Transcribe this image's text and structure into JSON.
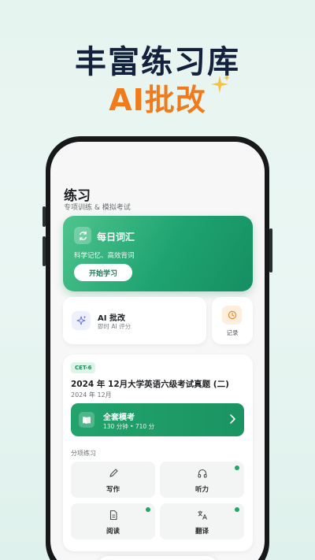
{
  "promo": {
    "headline_line1": "丰富练习库",
    "headline_line2": "AI批改"
  },
  "page": {
    "title": "练习",
    "subtitle": "专项训练 & 模拟考试"
  },
  "daily_vocab": {
    "title": "每日词汇",
    "subtitle": "科学记忆、高效背词",
    "button_label": "开始学习",
    "icon": "refresh-icon"
  },
  "ai_grading": {
    "title": "AI 批改",
    "subtitle": "即时 AI 评分",
    "icon": "sparkle-icon"
  },
  "records": {
    "label": "记录",
    "icon": "clock-icon"
  },
  "exam": {
    "level_badge": "CET-6",
    "title": "2024 年 12月大学英语六级考试真题 (二)",
    "date": "2024 年 12月",
    "mock": {
      "title": "全套模考",
      "subtitle": "130 分钟 • 710 分",
      "icon": "open-book-icon"
    },
    "section_label": "分项练习",
    "sections": [
      {
        "label": "写作",
        "icon": "pen-icon",
        "completed": false
      },
      {
        "label": "听力",
        "icon": "headphones-icon",
        "completed": true
      },
      {
        "label": "阅读",
        "icon": "document-icon",
        "completed": true
      },
      {
        "label": "翻译",
        "icon": "translate-icon",
        "completed": true
      }
    ]
  },
  "colors": {
    "brand_green": "#1ea370",
    "accent_orange": "#f07b1d",
    "headline_navy": "#14213d"
  }
}
